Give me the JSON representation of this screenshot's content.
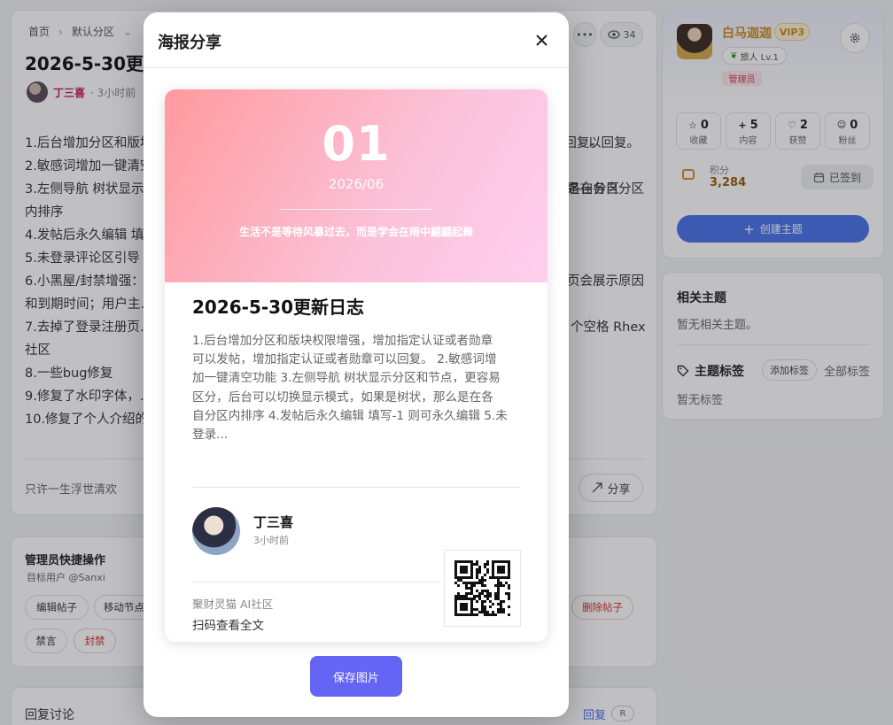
{
  "breadcrumb": {
    "home": "首页",
    "section": "默认分区"
  },
  "post": {
    "title": "2026-5-30更新日志",
    "author": "丁三喜",
    "time": "· 3小时前",
    "view_count": "34",
    "lines": [
      "1.后台增加分区和版块权限增强，增加指定认证或者勋章可以发帖，增加指定认证或者勋章可以回复。",
      "2.敏感词增加一键清空功能",
      "3.左侧导航 树状显示分区和节点，更容易区分，后台可以切换显示模式，如果是树状，那么是在各自分区",
      "内排序",
      "4.发帖后永久编辑 填写-1 则可永久编辑",
      "5.未登录评论区引导",
      "6.小黑屋/封禁增强：……用户主页会展示原因",
      "和到期时间；用户主……",
      "7.去掉了登录注册页……个空格 Rhex",
      "社区",
      "8.一些bug修复",
      "9.修复了水印字体，……",
      "10.修复了个人介绍的……"
    ],
    "line1_tail": "以回复。",
    "line3_tail": "是在各自分区",
    "line6_tail": "页会展示原因",
    "line7_tail": "个空格 Rhex",
    "signature": "只许一生浮世清欢",
    "share_label": "分享"
  },
  "admin": {
    "title": "管理员快捷操作",
    "target": "目标用户 @Sanxi",
    "actions": [
      "编辑帖子",
      "移动节点",
      "删除帖子",
      "禁言",
      "封禁"
    ]
  },
  "replies": {
    "title": "回复讨论",
    "reply_label": "回复",
    "shortcut": "R"
  },
  "user": {
    "name": "白马迦迦",
    "vip": "VIP3",
    "level": "旅人 Lv.1",
    "role": "管理员",
    "stats": [
      {
        "value": "0",
        "label": "收藏",
        "icon": "star-icon"
      },
      {
        "value": "5",
        "label": "内容",
        "icon": "plus-icon"
      },
      {
        "value": "2",
        "label": "获赞",
        "icon": "heart-icon"
      },
      {
        "value": "0",
        "label": "粉丝",
        "icon": "users-icon"
      }
    ],
    "points_label": "积分",
    "points": "3,284",
    "checkin": "已签到",
    "create": "创建主题"
  },
  "related": {
    "title": "相关主题",
    "empty": "暂无相关主题。"
  },
  "tags": {
    "title": "主题标签",
    "add": "添加标签",
    "all": "全部标签",
    "empty": "暂无标签"
  },
  "modal": {
    "title": "海报分享",
    "day": "01",
    "month": "2026/06",
    "quote": "生活不是等待风暴过去，而是学会在雨中翩翩起舞",
    "post_title": "2026-5-30更新日志",
    "excerpt": [
      "1.后台增加分区和版块权限增强，增加指定认证或者勋章",
      "可以发帖，增加指定认证或者勋章可以回复。 2.敏感词增",
      "加一键清空功能 3.左侧导航 树状显示分区和节点，更容易",
      "区分，后台可以切换显示模式，如果是树状，那么是在各",
      "自分区内排序 4.发帖后永久编辑 填写-1 则可永久编辑 5.未",
      "登录..."
    ],
    "author": "丁三喜",
    "time": "3小时前",
    "site": "聚财灵猫 AI社区",
    "scan": "扫码查看全文",
    "save": "保存图片"
  },
  "colors": {
    "accent": "#6464f5",
    "brand_blue": "#4a72ea",
    "author": "#c2185b",
    "banner_from": "#ff9a9e",
    "banner_to": "#fecfef"
  }
}
